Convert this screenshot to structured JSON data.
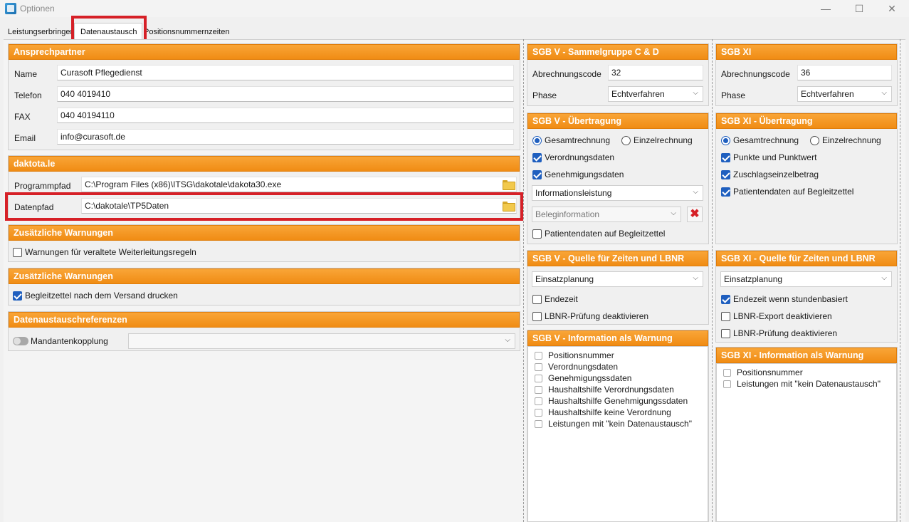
{
  "window": {
    "title": "Optionen",
    "minimize": "—",
    "maximize": "☐",
    "close": "✕"
  },
  "tabs": [
    "Leistungserbringer",
    "Datenaustausch",
    "Positionsnummernzeiten"
  ],
  "ansprechpartner": {
    "header": "Ansprechpartner",
    "name_label": "Name",
    "name_value": "Curasoft Pflegedienst",
    "telefon_label": "Telefon",
    "telefon_value": "040 4019410",
    "fax_label": "FAX",
    "fax_value": "040 40194110",
    "email_label": "Email",
    "email_value": "info@curasoft.de"
  },
  "dakota": {
    "header": "daktota.le",
    "programmpfad_label": "Programmpfad",
    "programmpfad_value": "C:\\Program Files (x86)\\ITSG\\dakotale\\dakota30.exe",
    "datenpfad_label": "Datenpfad",
    "datenpfad_value": "C:\\dakotale\\TP5Daten"
  },
  "warnungen1": {
    "header": "Zusätzliche Warnungen",
    "option": "Warnungen für veraltete Weiterleitungsregeln"
  },
  "warnungen2": {
    "header": "Zusätzliche Warnungen",
    "option": "Begleitzettel nach dem Versand drucken"
  },
  "referenzen": {
    "header": "Datenaustauschreferenzen",
    "toggle_label": "Mandantenkopplung"
  },
  "sgb5_gruppe": {
    "header": "SGB V - Sammelgruppe C & D",
    "code_label": "Abrechnungscode",
    "code_value": "32",
    "phase_label": "Phase",
    "phase_value": "Echtverfahren"
  },
  "sgb5_uebertragung": {
    "header": "SGB V - Übertragung",
    "radio1": "Gesamtrechnung",
    "radio2": "Einzelrechnung",
    "opt1": "Verordnungsdaten",
    "opt2": "Genehmigungsdaten",
    "select1": "Informationsleistung",
    "select2": "Beleginformation",
    "opt3": "Patientendaten auf Begleitzettel"
  },
  "sgb5_quelle": {
    "header": "SGB V - Quelle für Zeiten und LBNR",
    "select": "Einsatzplanung",
    "opt1": "Endezeit",
    "opt2": "LBNR-Prüfung deaktivieren"
  },
  "sgb5_info": {
    "header": "SGB V - Information als Warnung",
    "items": [
      "Positionsnummer",
      "Verordnungsdaten",
      "Genehmigungssdaten",
      "Haushaltshilfe Verordnungsdaten",
      "Haushaltshilfe Genehmigungssdaten",
      "Haushaltshilfe keine Verordnung",
      "Leistungen mit \"kein Datenaustausch\""
    ]
  },
  "sgb11_gruppe": {
    "header": "SGB XI",
    "code_label": "Abrechnungscode",
    "code_value": "36",
    "phase_label": "Phase",
    "phase_value": "Echtverfahren"
  },
  "sgb11_uebertragung": {
    "header": "SGB XI - Übertragung",
    "radio1": "Gesamtrechnung",
    "radio2": "Einzelrechnung",
    "opt1": "Punkte und Punktwert",
    "opt2": "Zuschlagseinzelbetrag",
    "opt3": "Patientendaten auf Begleitzettel"
  },
  "sgb11_quelle": {
    "header": "SGB XI - Quelle für Zeiten und LBNR",
    "select": "Einsatzplanung",
    "opt1": "Endezeit wenn stundenbasiert",
    "opt2": "LBNR-Export deaktivieren",
    "opt3": "LBNR-Prüfung deaktivieren"
  },
  "sgb11_info": {
    "header": "SGB XI - Information als Warnung",
    "items": [
      "Positionsnummer",
      "Leistungen mit \"kein Datenaustausch\""
    ]
  },
  "colors": {
    "header_orange": "#f39a1e",
    "highlight_red": "#d62027",
    "check_blue": "#1f5fbf"
  }
}
